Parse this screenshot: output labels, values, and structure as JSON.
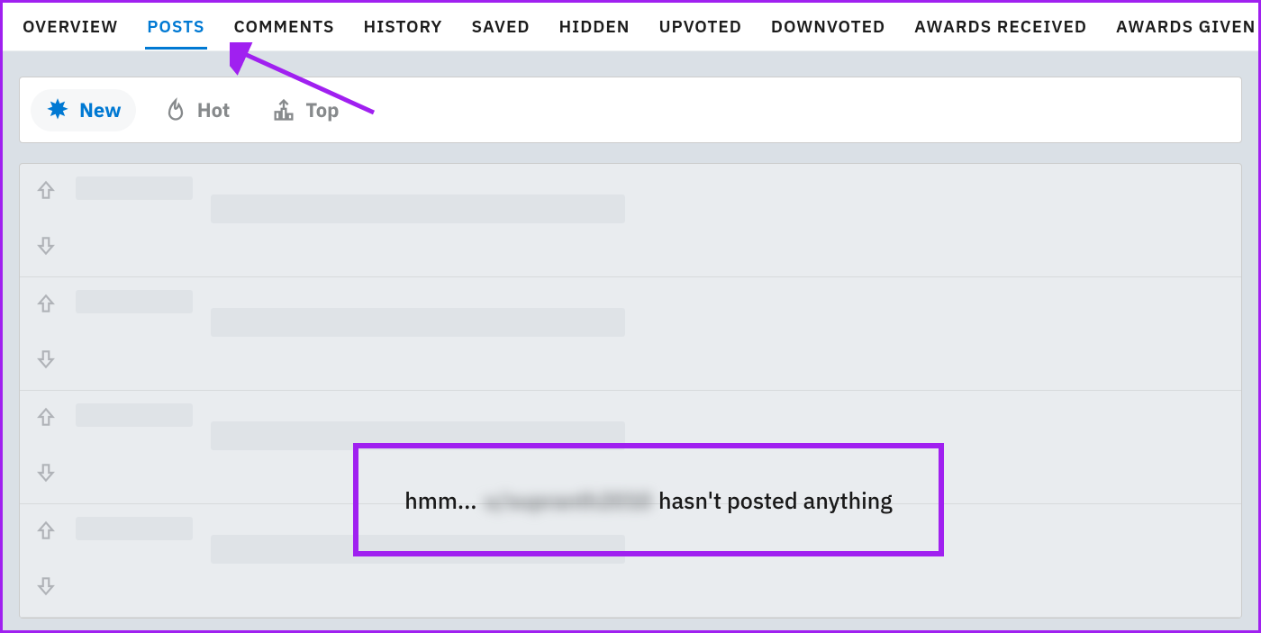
{
  "tabs": {
    "overview": "OVERVIEW",
    "posts": "POSTS",
    "comments": "COMMENTS",
    "history": "HISTORY",
    "saved": "SAVED",
    "hidden": "HIDDEN",
    "upvoted": "UPVOTED",
    "downvoted": "DOWNVOTED",
    "awards_received": "AWARDS RECEIVED",
    "awards_given": "AWARDS GIVEN",
    "active": "posts"
  },
  "sort": {
    "new": "New",
    "hot": "Hot",
    "top": "Top",
    "active": "new"
  },
  "empty": {
    "prefix": "hmm...",
    "username": "u/supranth2010",
    "suffix": "hasn't posted anything"
  },
  "colors": {
    "accent": "#0079d3",
    "annotation": "#a020f0"
  }
}
